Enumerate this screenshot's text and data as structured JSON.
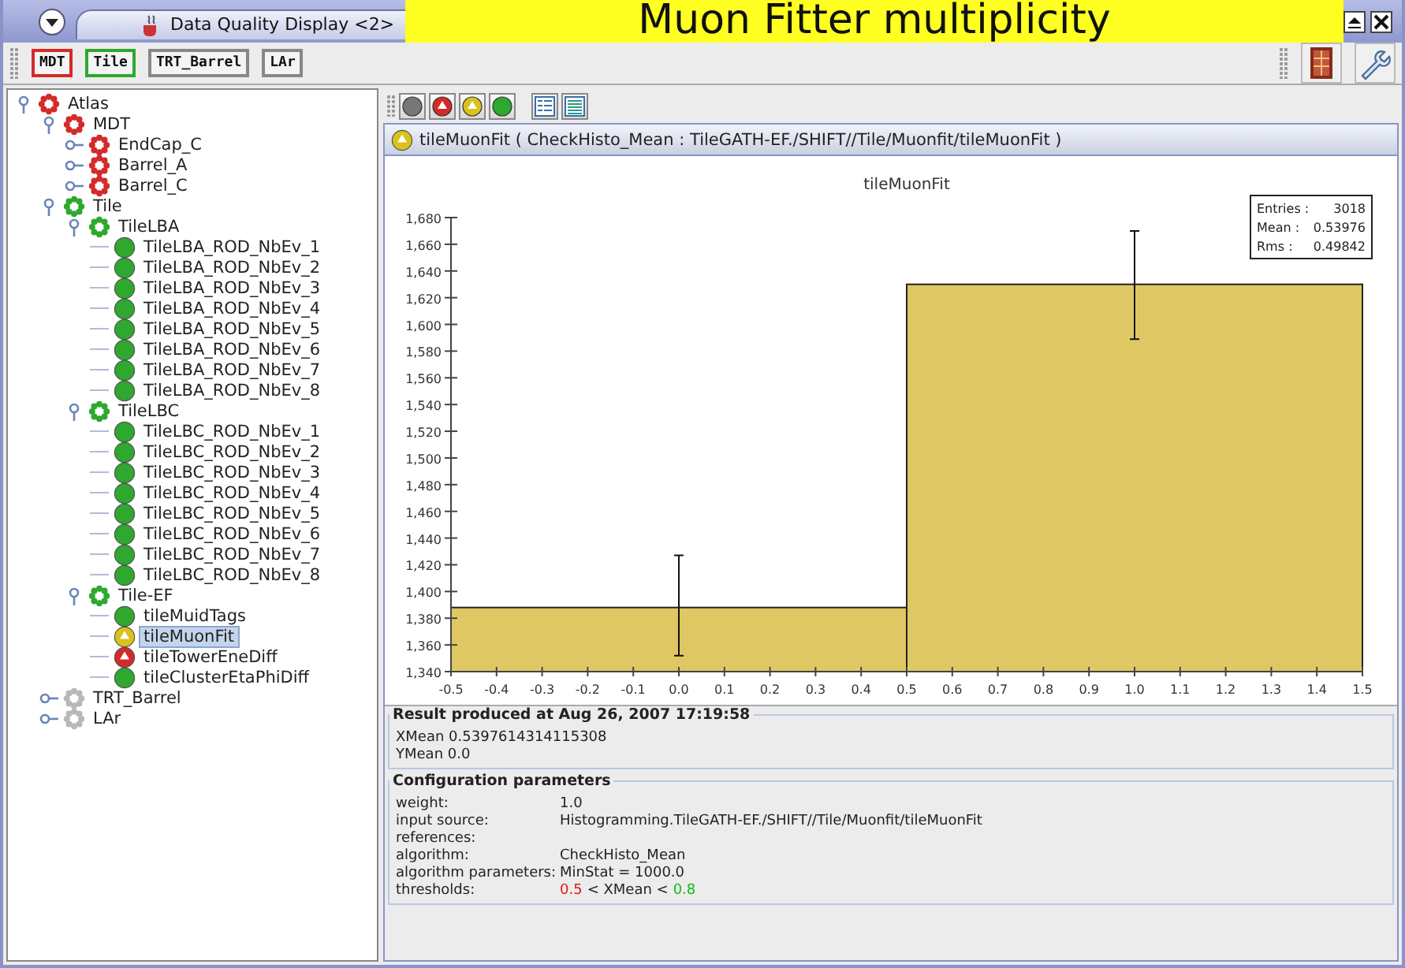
{
  "window": {
    "title": "Data Quality Display <2>"
  },
  "overlay_caption": "Muon Fitter multiplicity",
  "toolbar": {
    "buttons": [
      {
        "label": "MDT",
        "color": "#d42a2a"
      },
      {
        "label": "Tile",
        "color": "#2ea82e"
      },
      {
        "label": "TRT_Barrel",
        "color": "#888888"
      },
      {
        "label": "LAr",
        "color": "#888888"
      }
    ]
  },
  "tree": [
    {
      "label": "Atlas",
      "kind": "group",
      "color": "#d42a2a",
      "expanded": true,
      "selected": false,
      "children": [
        {
          "label": "MDT",
          "kind": "group",
          "color": "#d42a2a",
          "expanded": true,
          "selected": false,
          "children": [
            {
              "label": "EndCap_C",
              "kind": "group",
              "color": "#d42a2a",
              "expanded": false,
              "selected": false
            },
            {
              "label": "Barrel_A",
              "kind": "group",
              "color": "#d42a2a",
              "expanded": false,
              "selected": false
            },
            {
              "label": "Barrel_C",
              "kind": "group",
              "color": "#d42a2a",
              "expanded": false,
              "selected": false
            }
          ]
        },
        {
          "label": "Tile",
          "kind": "group",
          "color": "#2ea82e",
          "expanded": true,
          "selected": false,
          "children": [
            {
              "label": "TileLBA",
              "kind": "group",
              "color": "#2ea82e",
              "expanded": true,
              "selected": false,
              "children": [
                {
                  "label": "TileLBA_ROD_NbEv_1",
                  "kind": "leaf",
                  "color": "#2ea82e",
                  "warning": false,
                  "selected": false
                },
                {
                  "label": "TileLBA_ROD_NbEv_2",
                  "kind": "leaf",
                  "color": "#2ea82e",
                  "warning": false,
                  "selected": false
                },
                {
                  "label": "TileLBA_ROD_NbEv_3",
                  "kind": "leaf",
                  "color": "#2ea82e",
                  "warning": false,
                  "selected": false
                },
                {
                  "label": "TileLBA_ROD_NbEv_4",
                  "kind": "leaf",
                  "color": "#2ea82e",
                  "warning": false,
                  "selected": false
                },
                {
                  "label": "TileLBA_ROD_NbEv_5",
                  "kind": "leaf",
                  "color": "#2ea82e",
                  "warning": false,
                  "selected": false
                },
                {
                  "label": "TileLBA_ROD_NbEv_6",
                  "kind": "leaf",
                  "color": "#2ea82e",
                  "warning": false,
                  "selected": false
                },
                {
                  "label": "TileLBA_ROD_NbEv_7",
                  "kind": "leaf",
                  "color": "#2ea82e",
                  "warning": false,
                  "selected": false
                },
                {
                  "label": "TileLBA_ROD_NbEv_8",
                  "kind": "leaf",
                  "color": "#2ea82e",
                  "warning": false,
                  "selected": false
                }
              ]
            },
            {
              "label": "TileLBC",
              "kind": "group",
              "color": "#2ea82e",
              "expanded": true,
              "selected": false,
              "children": [
                {
                  "label": "TileLBC_ROD_NbEv_1",
                  "kind": "leaf",
                  "color": "#2ea82e",
                  "warning": false,
                  "selected": false
                },
                {
                  "label": "TileLBC_ROD_NbEv_2",
                  "kind": "leaf",
                  "color": "#2ea82e",
                  "warning": false,
                  "selected": false
                },
                {
                  "label": "TileLBC_ROD_NbEv_3",
                  "kind": "leaf",
                  "color": "#2ea82e",
                  "warning": false,
                  "selected": false
                },
                {
                  "label": "TileLBC_ROD_NbEv_4",
                  "kind": "leaf",
                  "color": "#2ea82e",
                  "warning": false,
                  "selected": false
                },
                {
                  "label": "TileLBC_ROD_NbEv_5",
                  "kind": "leaf",
                  "color": "#2ea82e",
                  "warning": false,
                  "selected": false
                },
                {
                  "label": "TileLBC_ROD_NbEv_6",
                  "kind": "leaf",
                  "color": "#2ea82e",
                  "warning": false,
                  "selected": false
                },
                {
                  "label": "TileLBC_ROD_NbEv_7",
                  "kind": "leaf",
                  "color": "#2ea82e",
                  "warning": false,
                  "selected": false
                },
                {
                  "label": "TileLBC_ROD_NbEv_8",
                  "kind": "leaf",
                  "color": "#2ea82e",
                  "warning": false,
                  "selected": false
                }
              ]
            },
            {
              "label": "Tile-EF",
              "kind": "group",
              "color": "#2ea82e",
              "expanded": true,
              "selected": false,
              "children": [
                {
                  "label": "tileMuidTags",
                  "kind": "leaf",
                  "color": "#2ea82e",
                  "warning": false,
                  "selected": false
                },
                {
                  "label": "tileMuonFit",
                  "kind": "leaf",
                  "color": "#d9c21e",
                  "warning": true,
                  "selected": true
                },
                {
                  "label": "tileTowerEneDiff",
                  "kind": "leaf",
                  "color": "#d42a2a",
                  "warning": true,
                  "selected": false
                },
                {
                  "label": "tileClusterEtaPhiDiff",
                  "kind": "leaf",
                  "color": "#2ea82e",
                  "warning": false,
                  "selected": false
                }
              ]
            }
          ]
        },
        {
          "label": "TRT_Barrel",
          "kind": "group",
          "color": "#b8b8b8",
          "expanded": false,
          "selected": false
        },
        {
          "label": "LAr",
          "kind": "group",
          "color": "#b8b8b8",
          "expanded": false,
          "selected": false
        }
      ]
    }
  ],
  "detail": {
    "color": "#d9c21e",
    "warning": true,
    "header": "tileMuonFit ( CheckHisto_Mean : TileGATH-EF./SHIFT//Tile/Muonfit/tileMuonFit )",
    "chart_data": {
      "type": "bar",
      "title": "tileMuonFit",
      "x": [
        0.0,
        1.0
      ],
      "series": [
        {
          "color": "#dfc863",
          "values": [
            1388,
            1630
          ],
          "errors": [
            [
              1352,
              1427
            ],
            [
              1589,
              1670
            ]
          ]
        }
      ],
      "xlim": [
        -0.5,
        1.5
      ],
      "ylim": [
        1340,
        1680
      ],
      "xticks": [
        {
          "value": -0.5,
          "label": "-0.5"
        },
        {
          "value": -0.4,
          "label": "-0.4"
        },
        {
          "value": -0.3,
          "label": "-0.3"
        },
        {
          "value": -0.2,
          "label": "-0.2"
        },
        {
          "value": -0.1,
          "label": "-0.1"
        },
        {
          "value": 0.0,
          "label": "0.0"
        },
        {
          "value": 0.1,
          "label": "0.1"
        },
        {
          "value": 0.2,
          "label": "0.2"
        },
        {
          "value": 0.3,
          "label": "0.3"
        },
        {
          "value": 0.4,
          "label": "0.4"
        },
        {
          "value": 0.5,
          "label": "0.5"
        },
        {
          "value": 0.6,
          "label": "0.6"
        },
        {
          "value": 0.7,
          "label": "0.7"
        },
        {
          "value": 0.8,
          "label": "0.8"
        },
        {
          "value": 0.9,
          "label": "0.9"
        },
        {
          "value": 1.0,
          "label": "1.0"
        },
        {
          "value": 1.1,
          "label": "1.1"
        },
        {
          "value": 1.2,
          "label": "1.2"
        },
        {
          "value": 1.3,
          "label": "1.3"
        },
        {
          "value": 1.4,
          "label": "1.4"
        },
        {
          "value": 1.5,
          "label": "1.5"
        }
      ],
      "yticks": [
        {
          "value": 1340,
          "label": "1,340"
        },
        {
          "value": 1360,
          "label": "1,360"
        },
        {
          "value": 1380,
          "label": "1,380"
        },
        {
          "value": 1400,
          "label": "1,400"
        },
        {
          "value": 1420,
          "label": "1,420"
        },
        {
          "value": 1440,
          "label": "1,440"
        },
        {
          "value": 1460,
          "label": "1,460"
        },
        {
          "value": 1480,
          "label": "1,480"
        },
        {
          "value": 1500,
          "label": "1,500"
        },
        {
          "value": 1520,
          "label": "1,520"
        },
        {
          "value": 1540,
          "label": "1,540"
        },
        {
          "value": 1560,
          "label": "1,560"
        },
        {
          "value": 1580,
          "label": "1,580"
        },
        {
          "value": 1600,
          "label": "1,600"
        },
        {
          "value": 1620,
          "label": "1,620"
        },
        {
          "value": 1640,
          "label": "1,640"
        },
        {
          "value": 1660,
          "label": "1,660"
        },
        {
          "value": 1680,
          "label": "1,680"
        }
      ]
    },
    "stats": [
      {
        "label": "Entries :",
        "value": "3018"
      },
      {
        "label": "Mean :",
        "value": "0.53976"
      },
      {
        "label": "Rms :",
        "value": "0.49842"
      }
    ],
    "result": {
      "title": "Result produced at Aug 26, 2007 17:19:58",
      "lines": [
        "XMean 0.5397614314115308",
        "YMean 0.0"
      ]
    },
    "config": {
      "title": "Configuration parameters",
      "rows": [
        {
          "label": "weight:",
          "value": "1.0"
        },
        {
          "label": "input source:",
          "value": "Histogramming.TileGATH-EF./SHIFT//Tile/Muonfit/tileMuonFit"
        },
        {
          "label": "references:"
        },
        {
          "label": "algorithm:",
          "value": "CheckHisto_Mean"
        },
        {
          "label": "algorithm parameters:",
          "value": "MinStat = 1000.0"
        },
        {
          "label": "thresholds:",
          "kind": "thresholds",
          "low": "0.5",
          "middle": "< XMean <",
          "high": "0.8"
        }
      ]
    }
  }
}
